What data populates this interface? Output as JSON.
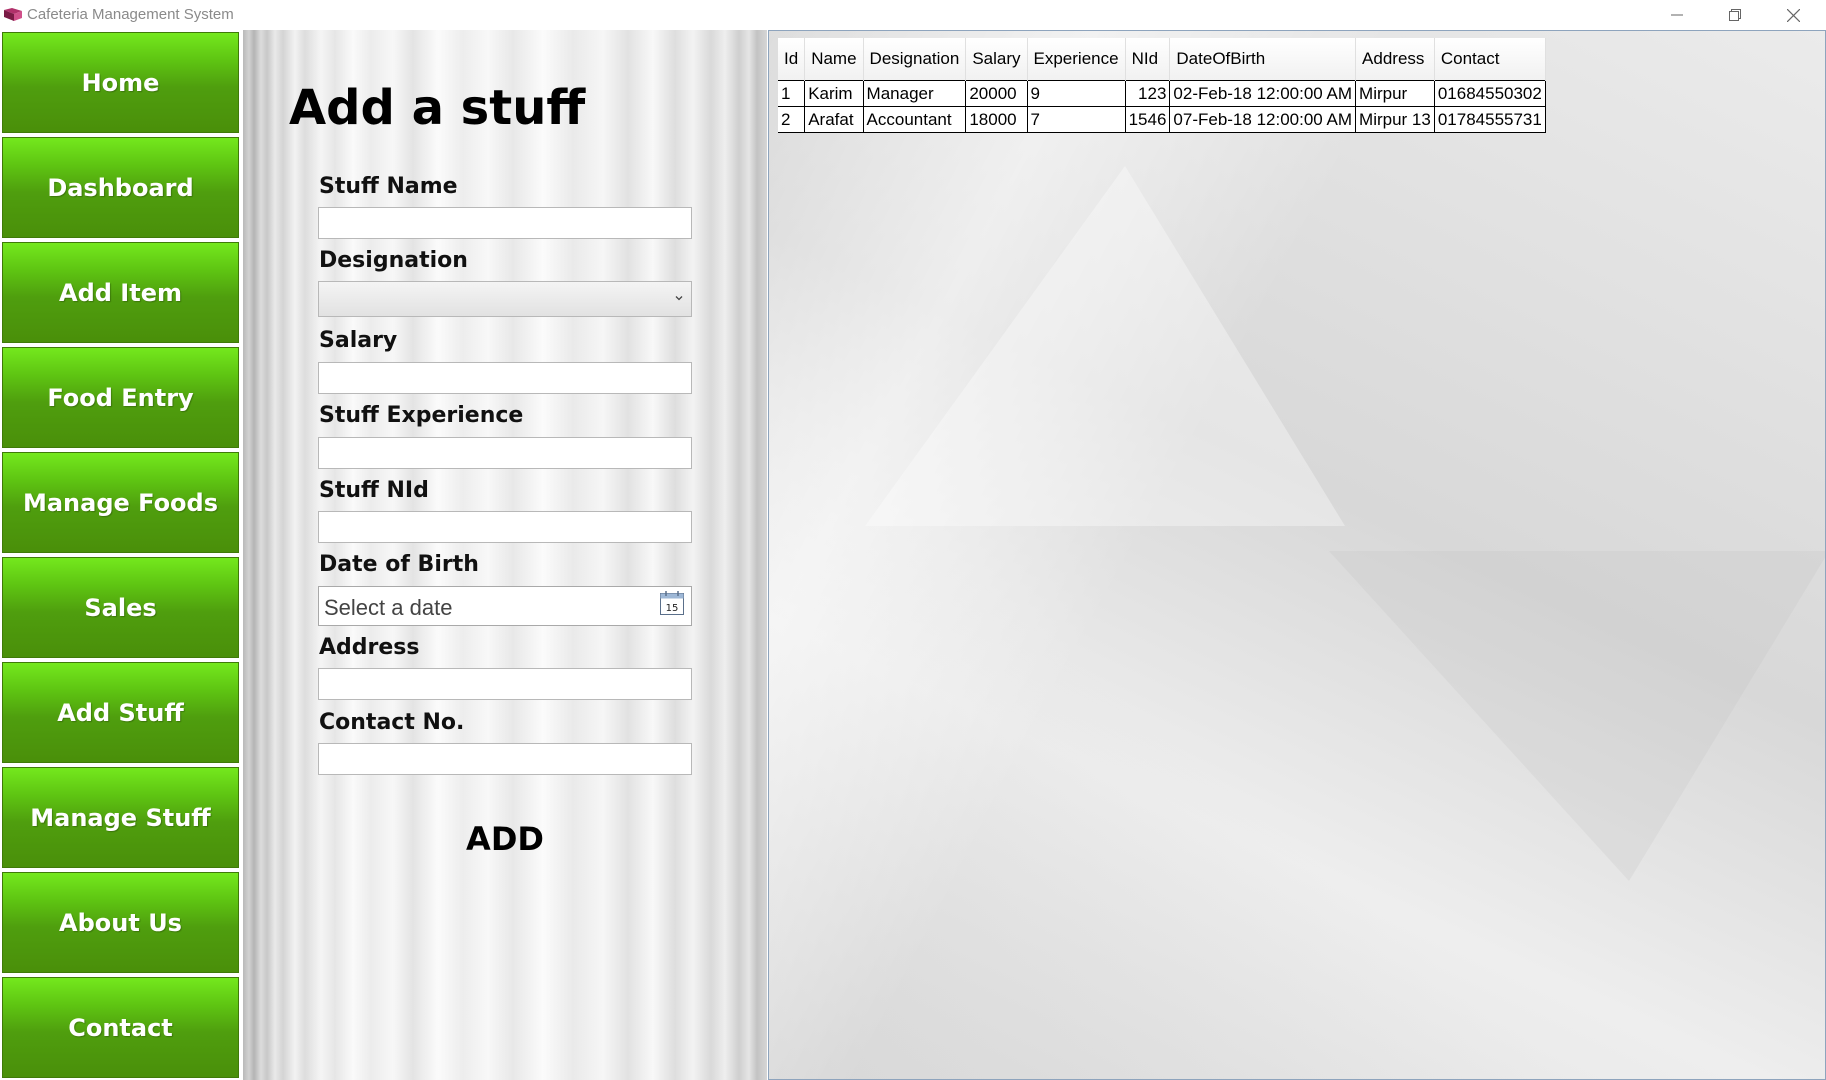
{
  "window": {
    "title": "Cafeteria Management System"
  },
  "sidebar": {
    "items": [
      {
        "label": "Home"
      },
      {
        "label": "Dashboard"
      },
      {
        "label": "Add Item"
      },
      {
        "label": "Food Entry"
      },
      {
        "label": "Manage Foods"
      },
      {
        "label": "Sales"
      },
      {
        "label": "Add Stuff"
      },
      {
        "label": "Manage Stuff"
      },
      {
        "label": "About Us"
      },
      {
        "label": "Contact"
      }
    ],
    "button_color": "#4f9e0e"
  },
  "form": {
    "title": "Add a stuff",
    "name_label": "Stuff Name",
    "name_value": "",
    "designation_label": "Designation",
    "designation_value": "",
    "salary_label": "Salary",
    "salary_value": "",
    "experience_label": "Stuff Experience",
    "experience_value": "",
    "nid_label": "Stuff NId",
    "nid_value": "",
    "dob_label": "Date of Birth",
    "dob_placeholder": "Select a date",
    "calendar_day": "15",
    "address_label": "Address",
    "address_value": "",
    "contact_label": "Contact No.",
    "contact_value": "",
    "add_label": "ADD"
  },
  "grid": {
    "headers": [
      "Id",
      "Name",
      "Designation",
      "Salary",
      "Experience",
      "NId",
      "DateOfBirth",
      "Address",
      "Contact"
    ],
    "rows": [
      [
        "1",
        "Karim",
        "Manager",
        "20000",
        "9",
        "123",
        "02-Feb-18 12:00:00 AM",
        "Mirpur",
        "01684550302"
      ],
      [
        "2",
        "Arafat",
        "Accountant",
        "18000",
        "7",
        "1546",
        "07-Feb-18 12:00:00 AM",
        "Mirpur 13",
        "01784555731"
      ]
    ]
  },
  "icons": {
    "app": "app-book-icon",
    "calendar": "calendar-icon",
    "dropdown": "chevron-down-icon"
  }
}
